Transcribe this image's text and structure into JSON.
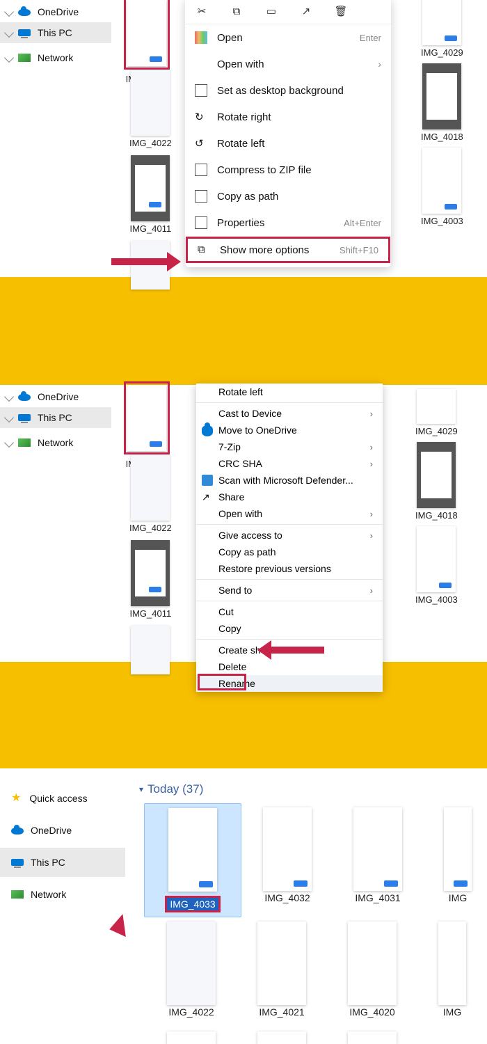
{
  "nav": {
    "onedrive": "OneDrive",
    "thispc": "This PC",
    "network": "Network",
    "quick": "Quick access"
  },
  "thumbs": {
    "a": [
      "IMG_4033",
      "IMG_4022",
      "IMG_4011"
    ],
    "right": [
      "IMG_4029",
      "IMG_4018",
      "IMG_4003"
    ]
  },
  "menu1": {
    "open": "Open",
    "open_sc": "Enter",
    "openwith": "Open with",
    "setbg": "Set as desktop background",
    "rotr": "Rotate right",
    "rotl": "Rotate left",
    "zip": "Compress to ZIP file",
    "copypath": "Copy as path",
    "props": "Properties",
    "props_sc": "Alt+Enter",
    "more": "Show more options",
    "more_sc": "Shift+F10"
  },
  "menu2": {
    "rotl": "Rotate left",
    "cast": "Cast to Device",
    "move": "Move to OneDrive",
    "sevenz": "7-Zip",
    "crc": "CRC SHA",
    "defender": "Scan with Microsoft Defender...",
    "share": "Share",
    "openwith": "Open with",
    "giveaccess": "Give access to",
    "copypath": "Copy as path",
    "restore": "Restore previous versions",
    "sendto": "Send to",
    "cut": "Cut",
    "copy": "Copy",
    "shortcut": "Create shortcut",
    "delete": "Delete",
    "rename": "Rename"
  },
  "p3": {
    "heading": "Today (37)",
    "sel": "IMG_4033",
    "row1": [
      "IMG_4032",
      "IMG_4031",
      "IMG"
    ],
    "row2": [
      "IMG_4022",
      "IMG_4021",
      "IMG_4020",
      "IMG"
    ]
  }
}
